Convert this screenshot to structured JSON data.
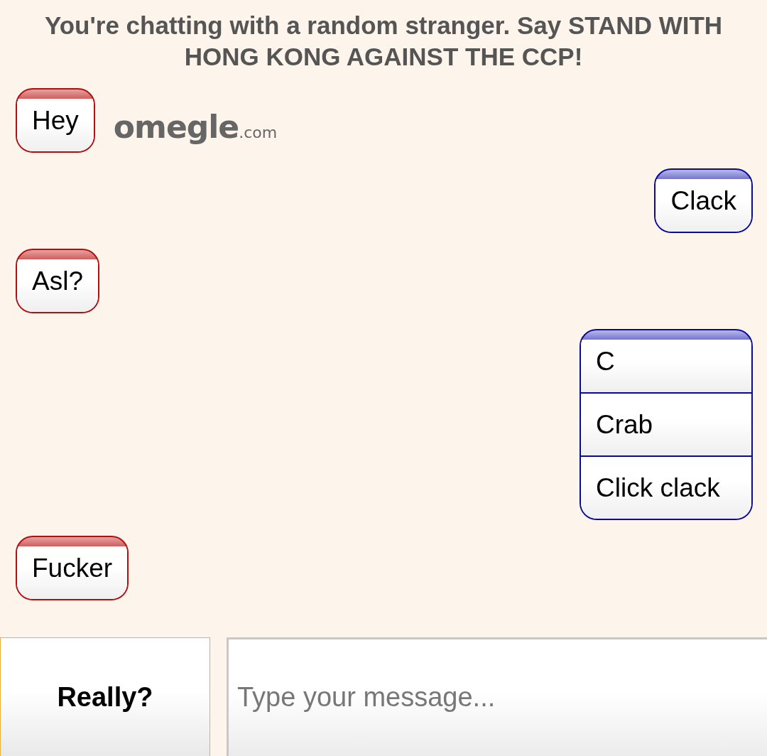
{
  "status": "You're chatting with a random stranger. Say STAND WITH HONG KONG AGAINST THE CCP!",
  "logo": {
    "name": "omegle",
    "suffix": ".com"
  },
  "messages": [
    {
      "kind": "stranger",
      "lines": [
        "Hey"
      ]
    },
    {
      "kind": "own",
      "lines": [
        "Clack"
      ]
    },
    {
      "kind": "stranger",
      "lines": [
        "Asl?"
      ]
    },
    {
      "kind": "own",
      "lines": [
        "C",
        "Crab",
        "Click clack"
      ]
    },
    {
      "kind": "stranger",
      "lines": [
        "Fucker"
      ]
    }
  ],
  "composer": {
    "button": "Really?",
    "placeholder": "Type your message..."
  }
}
